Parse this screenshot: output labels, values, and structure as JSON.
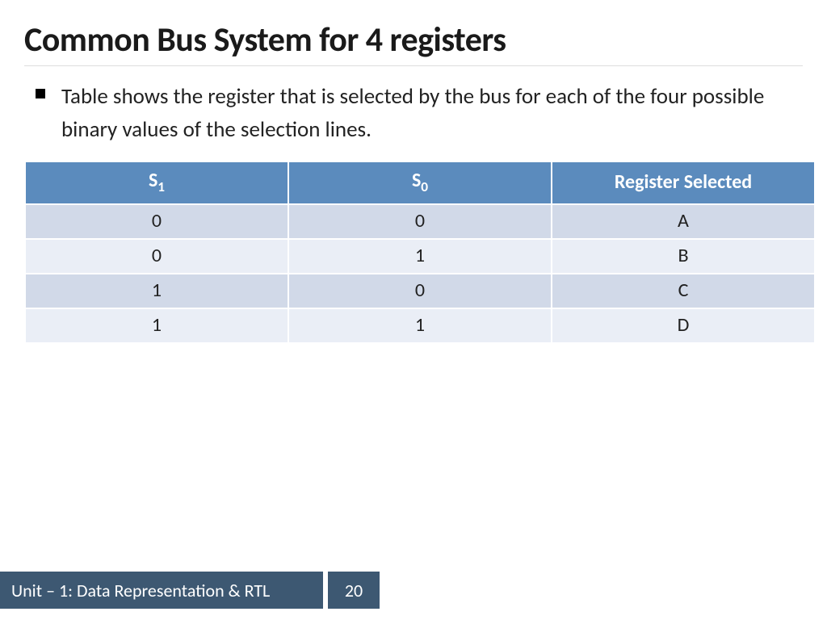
{
  "title": "Common Bus System for 4 registers",
  "bullet_text": "Table shows the register that is selected by the bus for each of the four possible binary values of the selection lines.",
  "chart_data": {
    "type": "table",
    "headers": {
      "s1": "S",
      "s1_sub": "1",
      "s0": "S",
      "s0_sub": "0",
      "reg": "Register Selected"
    },
    "rows": [
      {
        "s1": "0",
        "s0": "0",
        "reg": "A"
      },
      {
        "s1": "0",
        "s0": "1",
        "reg": "B"
      },
      {
        "s1": "1",
        "s0": "0",
        "reg": "C"
      },
      {
        "s1": "1",
        "s0": "1",
        "reg": "D"
      }
    ]
  },
  "footer": {
    "label": "Unit – 1: Data Representation & RTL",
    "page": "20"
  }
}
